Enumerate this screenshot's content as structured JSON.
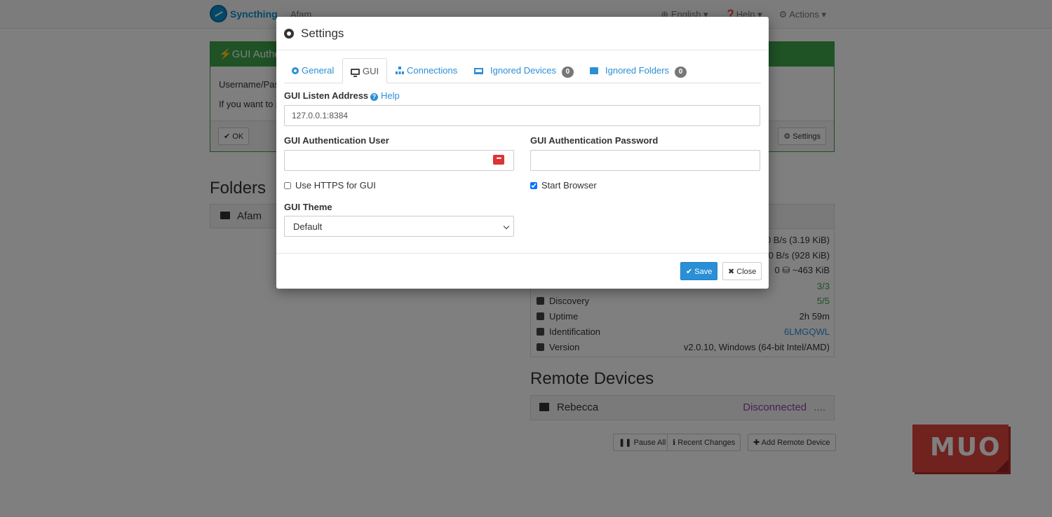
{
  "navbar": {
    "brand": "Syncthing",
    "device": "Afam",
    "language": "English ▾",
    "help": "Help ▾",
    "actions": "Actions ▾"
  },
  "notice": {
    "title": "GUI Authe",
    "line1": "Username/Pass",
    "line2": "If you want to p",
    "ok_label": "OK",
    "settings_label": "Settings"
  },
  "folders": {
    "heading": "Folders",
    "items": [
      {
        "label": "Afam"
      }
    ]
  },
  "this_device": {
    "rows": [
      {
        "label": "",
        "value": "0 B/s (3.19 KiB)"
      },
      {
        "label": "",
        "value": "0 B/s (928 KiB)"
      },
      {
        "label": "",
        "value": "0  ⛁ ~463 KiB"
      },
      {
        "label": "",
        "value": "3/3"
      },
      {
        "label": "Discovery",
        "value": "5/5"
      },
      {
        "label": "Uptime",
        "value": "2h 59m"
      },
      {
        "label": "Identification",
        "value": "6LMGQWL"
      },
      {
        "label": "Version",
        "value": "v2.0.10, Windows (64-bit Intel/AMD)"
      }
    ]
  },
  "remote_devices": {
    "heading": "Remote Devices",
    "items": [
      {
        "label": "Rebecca",
        "status": "Disconnected",
        "more": "...."
      }
    ],
    "pause_all": "Pause All",
    "recent_changes": "Recent Changes",
    "add_remote": "Add Remote Device"
  },
  "watermark": "MUO",
  "modal": {
    "title": "Settings",
    "tabs": [
      {
        "label": "General"
      },
      {
        "label": "GUI"
      },
      {
        "label": "Connections"
      },
      {
        "label": "Ignored Devices",
        "badge": "0"
      },
      {
        "label": "Ignored Folders",
        "badge": "0"
      }
    ],
    "listen_address_label": "GUI Listen Address",
    "help_label": "Help",
    "listen_address_value": "127.0.0.1:8384",
    "auth_user_label": "GUI Authentication User",
    "auth_user_value": "",
    "auth_password_label": "GUI Authentication Password",
    "auth_password_value": "",
    "use_https_label": "Use HTTPS for GUI",
    "use_https_checked": false,
    "start_browser_label": "Start Browser",
    "start_browser_checked": true,
    "theme_label": "GUI Theme",
    "theme_value": "Default",
    "save_label": "Save",
    "close_label": "Close"
  },
  "colors": {
    "accent": "#2a8fd6",
    "success": "#3ea54a",
    "danger": "#e0443e"
  }
}
